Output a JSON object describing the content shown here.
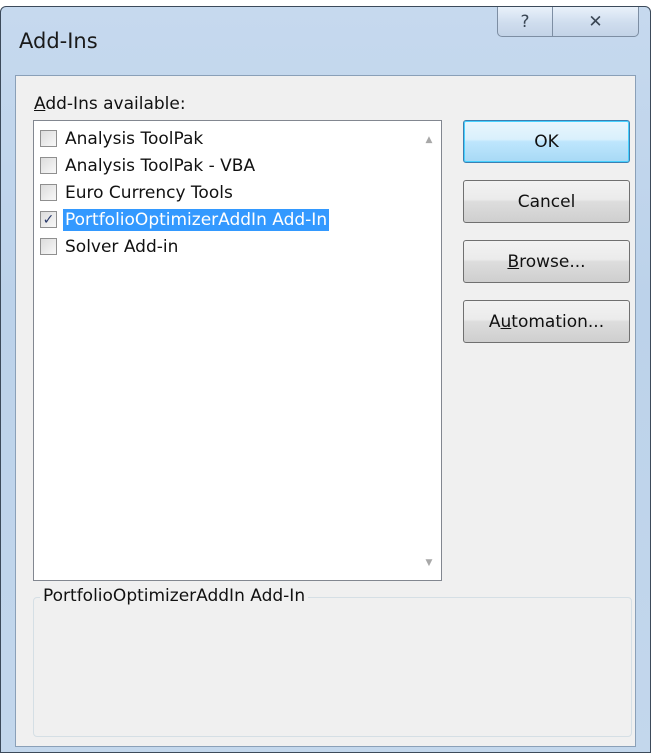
{
  "window": {
    "title": "Add-Ins",
    "help_glyph": "?",
    "close_glyph": "✕"
  },
  "addins": {
    "label_prefix": "A",
    "label_rest": "dd-Ins available:",
    "items": [
      {
        "label": "Analysis ToolPak",
        "checked": false,
        "selected": false
      },
      {
        "label": "Analysis ToolPak - VBA",
        "checked": false,
        "selected": false
      },
      {
        "label": "Euro Currency Tools",
        "checked": false,
        "selected": false
      },
      {
        "label": "PortfolioOptimizerAddIn Add-In",
        "checked": true,
        "selected": true
      },
      {
        "label": "Solver Add-in",
        "checked": false,
        "selected": false
      }
    ]
  },
  "buttons": {
    "ok": "OK",
    "cancel": "Cancel",
    "browse_ul": "B",
    "browse_rest": "rowse...",
    "automation_pre": "A",
    "automation_ul": "u",
    "automation_rest": "tomation..."
  },
  "description": {
    "title": "PortfolioOptimizerAddIn Add-In"
  },
  "icons": {
    "check": "✓",
    "scroll_up": "▲",
    "scroll_down": "▼"
  },
  "colors": {
    "selection": "#3399ff",
    "dialog_frame": "#c3d7ec"
  }
}
